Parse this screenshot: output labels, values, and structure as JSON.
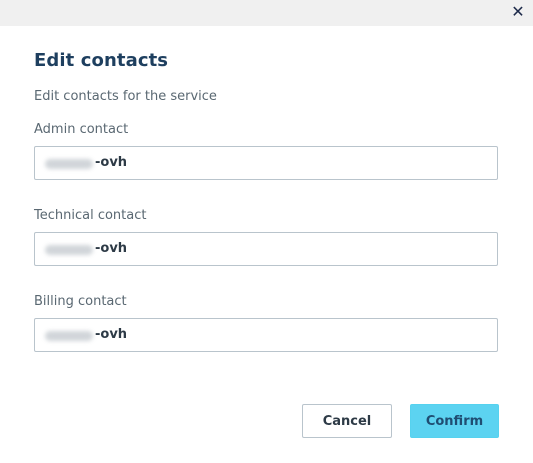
{
  "dialog": {
    "title": "Edit contacts",
    "subtitle": "Edit contacts for the service",
    "close_icon": "close-icon"
  },
  "fields": [
    {
      "label": "Admin contact",
      "value_suffix": "-ovh"
    },
    {
      "label": "Technical contact",
      "value_suffix": "-ovh"
    },
    {
      "label": "Billing contact",
      "value_suffix": "-ovh"
    }
  ],
  "buttons": {
    "cancel": "Cancel",
    "confirm": "Confirm"
  },
  "colors": {
    "title": "#1e3f5f",
    "confirm_bg": "#5cd3f1",
    "topbar_bg": "#f0f0f0"
  }
}
